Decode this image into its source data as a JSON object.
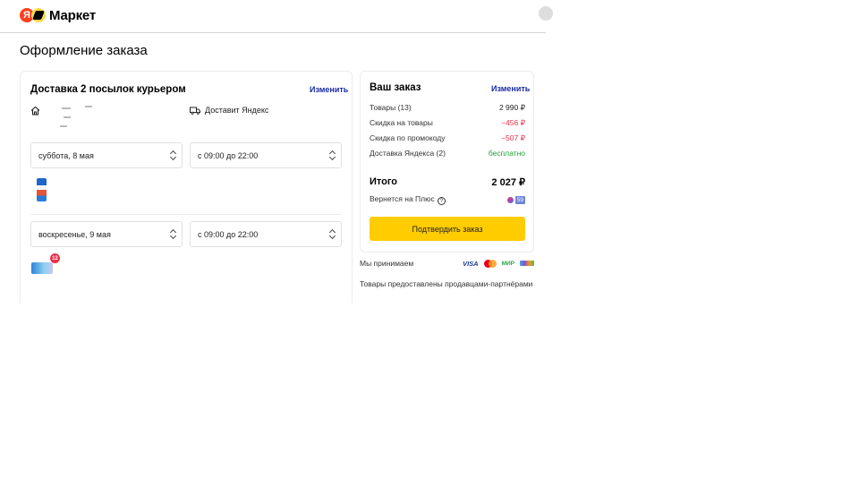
{
  "header": {
    "logo_letter": "Я",
    "logo_text": "Маркет"
  },
  "page_title": "Оформление заказа",
  "delivery": {
    "title": "Доставка 2 посылок курьером",
    "edit_label": "Изменить",
    "carrier": "Доставит Яндекс",
    "slots": [
      {
        "date": "суббота, 8 мая",
        "time": "с 09:00 до 22:00"
      },
      {
        "date": "воскресенье, 9 мая",
        "time": "с 09:00 до 22:00"
      }
    ],
    "second_item_count": "12"
  },
  "summary": {
    "title": "Ваш заказ",
    "edit_label": "Изменить",
    "rows": [
      {
        "label": "Товары (13)",
        "value": "2 990 ₽"
      },
      {
        "label": "Скидка на товары",
        "value": "−456 ₽"
      },
      {
        "label": "Скидка по промокоду",
        "value": "−507 ₽"
      },
      {
        "label": "Доставка Яндекса (2)",
        "value": "бесплатно"
      }
    ],
    "total_label": "Итого",
    "total_value": "2 027 ₽",
    "plus_label": "Вернется на Плюс",
    "plus_value": "59",
    "confirm_label": "Подтвердить заказ"
  },
  "payments": {
    "label": "Мы принимаем",
    "visa": "VISA",
    "mir": "МИР"
  },
  "sellers_note": "Товары предоставлены продавцами-партнёрами",
  "colors": {
    "accent_button": "#ffcc00",
    "link": "#1a2ba3",
    "discount": "#e8314a",
    "free": "#21a038"
  }
}
